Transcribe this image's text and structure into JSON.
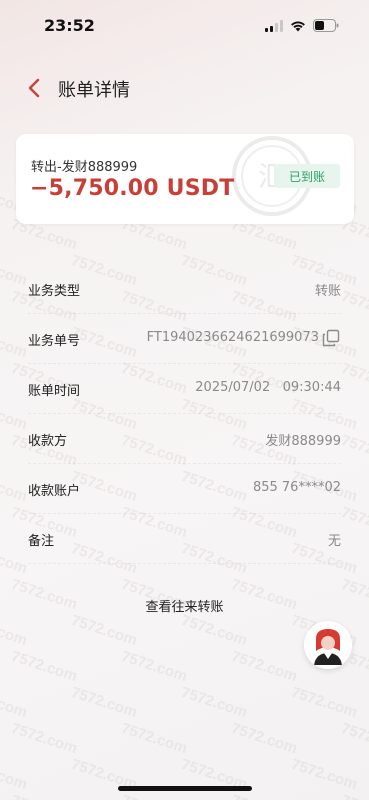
{
  "status_bar": {
    "time": "23:52"
  },
  "header": {
    "title": "账单详情"
  },
  "summary": {
    "subtitle": "转出-发财888999",
    "amount": "−5,750.00 USDT",
    "status_badge": "已到账",
    "seal_text": "汇"
  },
  "details": [
    {
      "label": "业务类型",
      "value": "转账"
    },
    {
      "label": "业务单号",
      "value": "FT1940236624621699073"
    },
    {
      "label": "账单时间",
      "value": "2025/07/02   09:30:44"
    },
    {
      "label": "收款方",
      "value": "发财888999"
    },
    {
      "label": "收款账户",
      "value": "855 76****02"
    },
    {
      "label": "备注",
      "value": "无"
    }
  ],
  "view_transfers_link": "查看往来转账",
  "watermark_text": "7572.com",
  "colors": {
    "amount_red": "#c93f38",
    "back_arrow": "#c4463b",
    "badge_green": "#2aa164",
    "badge_bg": "#e8f5ee"
  },
  "icons": {
    "back": "chevron-left-icon",
    "copy": "copy-icon",
    "signal": "cellular-signal-icon",
    "wifi": "wifi-icon",
    "battery": "battery-icon"
  }
}
